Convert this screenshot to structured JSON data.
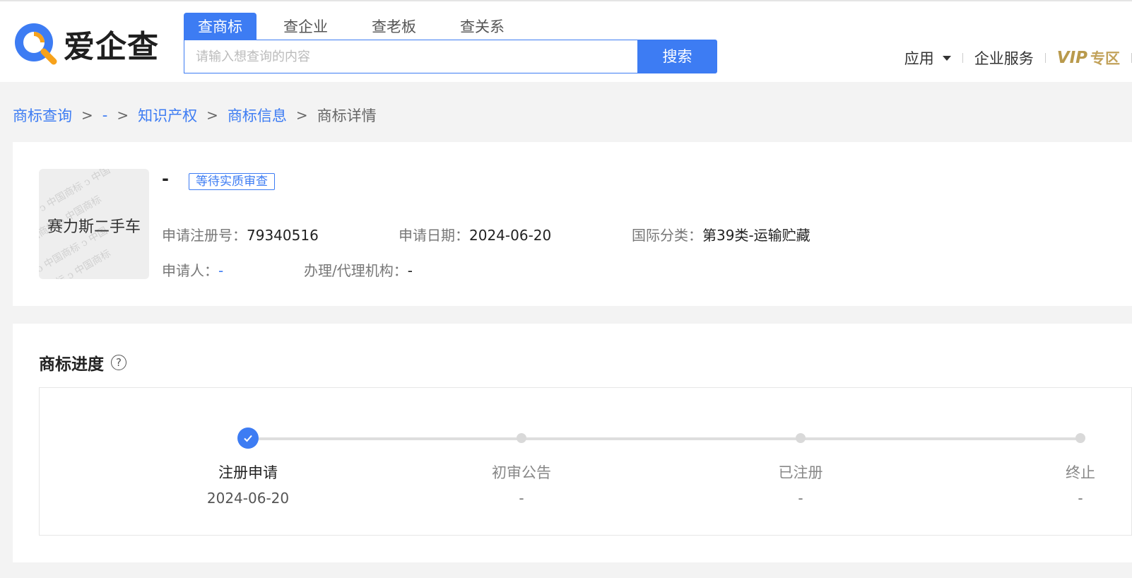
{
  "header": {
    "logo_text": "爱企查",
    "tabs": [
      {
        "label": "查商标"
      },
      {
        "label": "查企业"
      },
      {
        "label": "查老板"
      },
      {
        "label": "查关系"
      }
    ],
    "search": {
      "placeholder": "请输入想查询的内容",
      "button": "搜索"
    },
    "nav": {
      "apps": "应用",
      "services": "企业服务",
      "vip": "VIP",
      "vip_zone": "专区"
    }
  },
  "breadcrumb": {
    "items": [
      "商标查询",
      "-",
      "知识产权",
      "商标信息"
    ],
    "current": "商标详情",
    "separator": ">"
  },
  "trademark": {
    "image_text": "赛力斯二手车",
    "name": "-",
    "status": "等待实质审查",
    "reg_no_label": "申请注册号：",
    "reg_no": "79340516",
    "apply_date_label": "申请日期：",
    "apply_date": "2024-06-20",
    "intl_class_label": "国际分类：",
    "intl_class": "第39类-运输贮藏",
    "applicant_label": "申请人：",
    "applicant": "-",
    "agency_label": "办理/代理机构：",
    "agency": "-"
  },
  "progress": {
    "title": "商标进度",
    "help": "?",
    "steps": [
      {
        "label": "注册申请",
        "date": "2024-06-20",
        "done": true
      },
      {
        "label": "初审公告",
        "date": "-",
        "done": false
      },
      {
        "label": "已注册",
        "date": "-",
        "done": false
      },
      {
        "label": "终止",
        "date": "-",
        "done": false
      }
    ]
  },
  "colors": {
    "accent": "#3d7cf3",
    "vip": "#b99a4c",
    "background": "#f3f3f3"
  }
}
